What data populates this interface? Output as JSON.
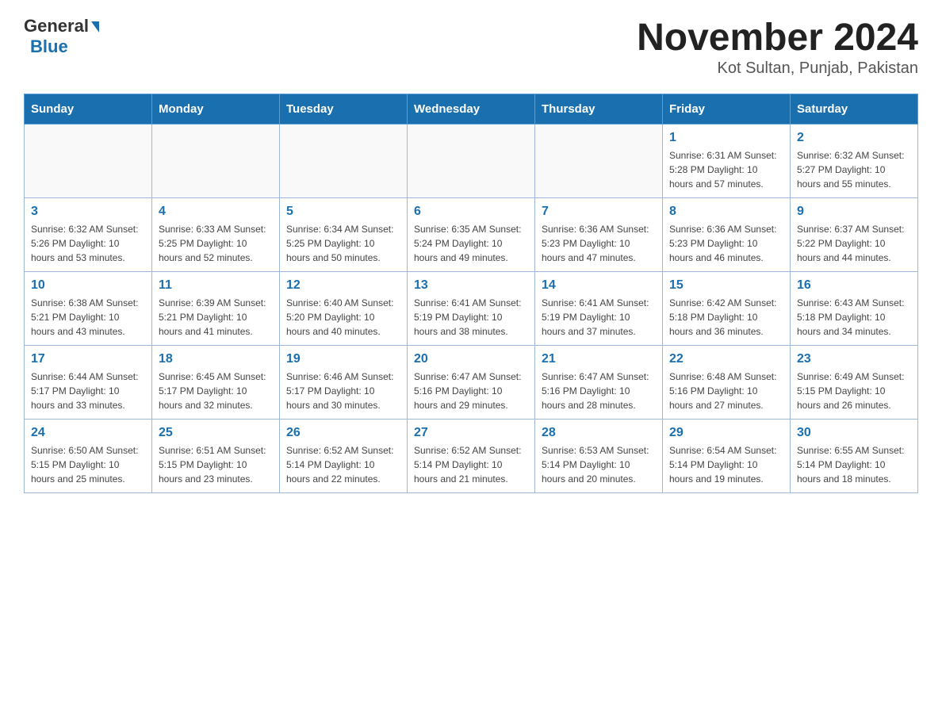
{
  "header": {
    "logo_general": "General",
    "logo_blue": "Blue",
    "month_title": "November 2024",
    "location": "Kot Sultan, Punjab, Pakistan"
  },
  "weekdays": [
    "Sunday",
    "Monday",
    "Tuesday",
    "Wednesday",
    "Thursday",
    "Friday",
    "Saturday"
  ],
  "weeks": [
    [
      {
        "day": "",
        "info": ""
      },
      {
        "day": "",
        "info": ""
      },
      {
        "day": "",
        "info": ""
      },
      {
        "day": "",
        "info": ""
      },
      {
        "day": "",
        "info": ""
      },
      {
        "day": "1",
        "info": "Sunrise: 6:31 AM\nSunset: 5:28 PM\nDaylight: 10 hours and 57 minutes."
      },
      {
        "day": "2",
        "info": "Sunrise: 6:32 AM\nSunset: 5:27 PM\nDaylight: 10 hours and 55 minutes."
      }
    ],
    [
      {
        "day": "3",
        "info": "Sunrise: 6:32 AM\nSunset: 5:26 PM\nDaylight: 10 hours and 53 minutes."
      },
      {
        "day": "4",
        "info": "Sunrise: 6:33 AM\nSunset: 5:25 PM\nDaylight: 10 hours and 52 minutes."
      },
      {
        "day": "5",
        "info": "Sunrise: 6:34 AM\nSunset: 5:25 PM\nDaylight: 10 hours and 50 minutes."
      },
      {
        "day": "6",
        "info": "Sunrise: 6:35 AM\nSunset: 5:24 PM\nDaylight: 10 hours and 49 minutes."
      },
      {
        "day": "7",
        "info": "Sunrise: 6:36 AM\nSunset: 5:23 PM\nDaylight: 10 hours and 47 minutes."
      },
      {
        "day": "8",
        "info": "Sunrise: 6:36 AM\nSunset: 5:23 PM\nDaylight: 10 hours and 46 minutes."
      },
      {
        "day": "9",
        "info": "Sunrise: 6:37 AM\nSunset: 5:22 PM\nDaylight: 10 hours and 44 minutes."
      }
    ],
    [
      {
        "day": "10",
        "info": "Sunrise: 6:38 AM\nSunset: 5:21 PM\nDaylight: 10 hours and 43 minutes."
      },
      {
        "day": "11",
        "info": "Sunrise: 6:39 AM\nSunset: 5:21 PM\nDaylight: 10 hours and 41 minutes."
      },
      {
        "day": "12",
        "info": "Sunrise: 6:40 AM\nSunset: 5:20 PM\nDaylight: 10 hours and 40 minutes."
      },
      {
        "day": "13",
        "info": "Sunrise: 6:41 AM\nSunset: 5:19 PM\nDaylight: 10 hours and 38 minutes."
      },
      {
        "day": "14",
        "info": "Sunrise: 6:41 AM\nSunset: 5:19 PM\nDaylight: 10 hours and 37 minutes."
      },
      {
        "day": "15",
        "info": "Sunrise: 6:42 AM\nSunset: 5:18 PM\nDaylight: 10 hours and 36 minutes."
      },
      {
        "day": "16",
        "info": "Sunrise: 6:43 AM\nSunset: 5:18 PM\nDaylight: 10 hours and 34 minutes."
      }
    ],
    [
      {
        "day": "17",
        "info": "Sunrise: 6:44 AM\nSunset: 5:17 PM\nDaylight: 10 hours and 33 minutes."
      },
      {
        "day": "18",
        "info": "Sunrise: 6:45 AM\nSunset: 5:17 PM\nDaylight: 10 hours and 32 minutes."
      },
      {
        "day": "19",
        "info": "Sunrise: 6:46 AM\nSunset: 5:17 PM\nDaylight: 10 hours and 30 minutes."
      },
      {
        "day": "20",
        "info": "Sunrise: 6:47 AM\nSunset: 5:16 PM\nDaylight: 10 hours and 29 minutes."
      },
      {
        "day": "21",
        "info": "Sunrise: 6:47 AM\nSunset: 5:16 PM\nDaylight: 10 hours and 28 minutes."
      },
      {
        "day": "22",
        "info": "Sunrise: 6:48 AM\nSunset: 5:16 PM\nDaylight: 10 hours and 27 minutes."
      },
      {
        "day": "23",
        "info": "Sunrise: 6:49 AM\nSunset: 5:15 PM\nDaylight: 10 hours and 26 minutes."
      }
    ],
    [
      {
        "day": "24",
        "info": "Sunrise: 6:50 AM\nSunset: 5:15 PM\nDaylight: 10 hours and 25 minutes."
      },
      {
        "day": "25",
        "info": "Sunrise: 6:51 AM\nSunset: 5:15 PM\nDaylight: 10 hours and 23 minutes."
      },
      {
        "day": "26",
        "info": "Sunrise: 6:52 AM\nSunset: 5:14 PM\nDaylight: 10 hours and 22 minutes."
      },
      {
        "day": "27",
        "info": "Sunrise: 6:52 AM\nSunset: 5:14 PM\nDaylight: 10 hours and 21 minutes."
      },
      {
        "day": "28",
        "info": "Sunrise: 6:53 AM\nSunset: 5:14 PM\nDaylight: 10 hours and 20 minutes."
      },
      {
        "day": "29",
        "info": "Sunrise: 6:54 AM\nSunset: 5:14 PM\nDaylight: 10 hours and 19 minutes."
      },
      {
        "day": "30",
        "info": "Sunrise: 6:55 AM\nSunset: 5:14 PM\nDaylight: 10 hours and 18 minutes."
      }
    ]
  ]
}
